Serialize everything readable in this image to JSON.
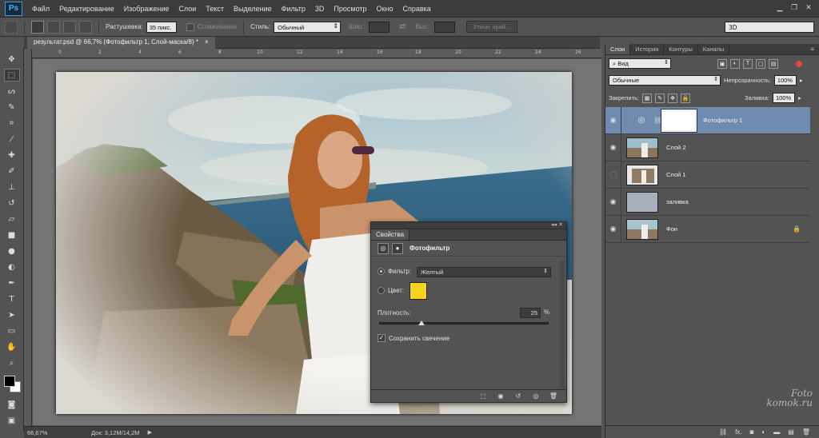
{
  "app": {
    "logo": "Ps"
  },
  "menu": [
    "Файл",
    "Редактирование",
    "Изображение",
    "Слои",
    "Текст",
    "Выделение",
    "Фильтр",
    "3D",
    "Просмотр",
    "Окно",
    "Справка"
  ],
  "options": {
    "feather_label": "Растушевка:",
    "feather_value": "35 пикс.",
    "antialias_label": "Сглаживание",
    "style_label": "Стиль:",
    "style_value": "Обычный",
    "width_label": "Шир.:",
    "height_label": "Выс.:",
    "refine_edge": "Уточн. край...",
    "workspace": "3D"
  },
  "document": {
    "tab_title": "результат.psd @ 66,7% (Фотофильтр 1, Слой-маска/8) *",
    "close": "×",
    "zoom": "66,67%",
    "doc_info": "Док: 3,12M/14,2M",
    "ruler_marks": [
      "0",
      "2",
      "4",
      "6",
      "8",
      "10",
      "12",
      "14",
      "16",
      "18",
      "20",
      "22",
      "24",
      "26"
    ]
  },
  "properties": {
    "tab": "Свойства",
    "title": "Фотофильтр",
    "filter_label": "Фильтр:",
    "filter_value": "Желтый",
    "color_label": "Цвет:",
    "color_swatch": "#f7d31c",
    "density_label": "Плотность:",
    "density_value": "25",
    "density_unit": "%",
    "density": 25,
    "preserve_label": "Сохранить свечение",
    "preserve_checked": true
  },
  "layers_panel": {
    "tabs": [
      "Слои",
      "История",
      "Контуры",
      "Каналы"
    ],
    "kind_filter": "Вид",
    "blend_mode": "Обычные",
    "opacity_label": "Непрозрачность:",
    "opacity_value": "100%",
    "lock_label": "Закрепить:",
    "fill_label": "Заливка:",
    "fill_value": "100%",
    "layers": [
      {
        "name": "Фотофильтр 1",
        "visible": true,
        "selected": true
      },
      {
        "name": "Слой 2",
        "visible": true,
        "selected": false
      },
      {
        "name": "Слой 1",
        "visible": false,
        "selected": false
      },
      {
        "name": "заливка",
        "visible": true,
        "selected": false
      },
      {
        "name": "Фон",
        "visible": true,
        "selected": false
      }
    ],
    "fill_layer_color": "#a8b0bc"
  },
  "watermark": {
    "line1": "Foto",
    "line2": "komok.ru"
  }
}
